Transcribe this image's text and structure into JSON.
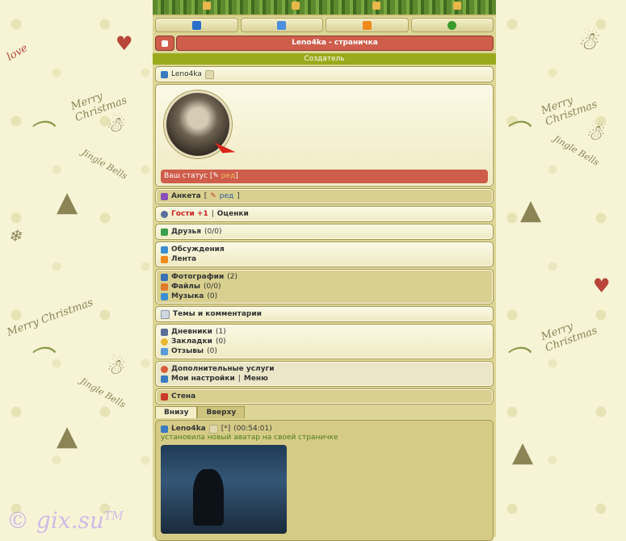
{
  "window": {
    "title": "Leno4ka - страничка",
    "creator_label": "Создатель"
  },
  "top_icons": [
    "user-icon",
    "mail-icon",
    "rss-icon",
    "refresh-icon"
  ],
  "profile": {
    "username": "Leno4ka",
    "status_prefix": "Ваш статус [",
    "status_edit": "ред",
    "status_suffix": "]"
  },
  "menu": {
    "anketa_label": "Анкета",
    "anketa_edit": "ред",
    "guests_label": "Гости +1",
    "ratings_label": "Оценки",
    "friends_label": "Друзья",
    "friends_count": "(0/0)",
    "discussions_label": "Обсуждения",
    "feed_label": "Лента",
    "photos_label": "Фотографии",
    "photos_count": "(2)",
    "files_label": "Файлы",
    "files_count": "(0/0)",
    "music_label": "Музыка",
    "music_count": "(0)",
    "themes_label": "Темы и комментарии",
    "diaries_label": "Дневники",
    "diaries_count": "(1)",
    "bookmarks_label": "Закладки",
    "bookmarks_count": "(0)",
    "reviews_label": "Отзывы",
    "reviews_count": "(0)",
    "extra_services_label": "Дополнительные услуги",
    "settings_label": "Мои настройки",
    "menu_label": "Меню",
    "wall_label": "Стена"
  },
  "tabs": [
    "Внизу",
    "Вверху"
  ],
  "feed_item": {
    "author": "Leno4ka",
    "marker": "[*]",
    "time": "(00:54:01)",
    "text": "установила новый аватар на своей страничке"
  },
  "wallpaper": {
    "merry": "Merry Christmas",
    "jingle": "Jingle Bells",
    "love": "love"
  },
  "watermark": {
    "text": "© gix.su",
    "tm": "TM"
  },
  "colors": {
    "accent_red": "#cf5d4c",
    "creator_bar": "#9aaa1c",
    "panel_bg": "#efeac2"
  }
}
